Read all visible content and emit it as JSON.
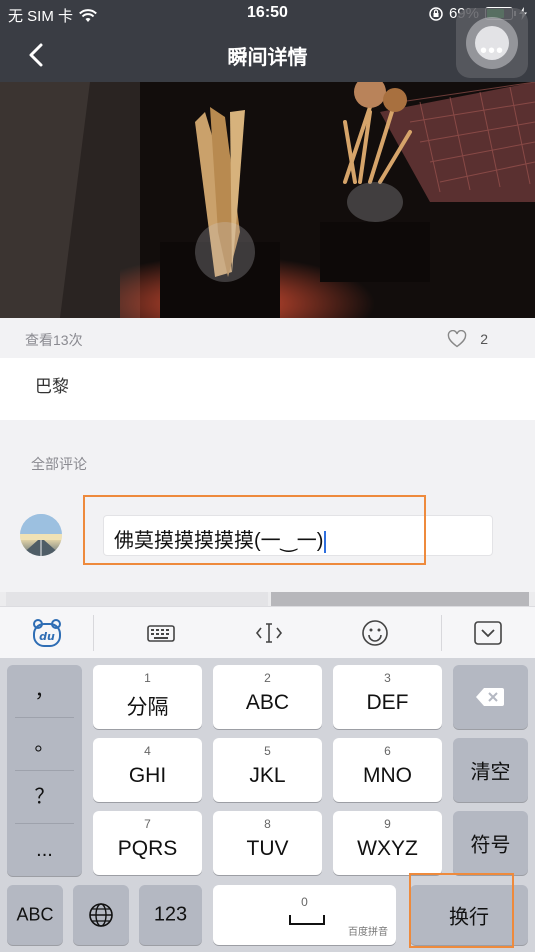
{
  "status_bar": {
    "carrier": "无 SIM 卡",
    "time": "16:50",
    "battery": "69%"
  },
  "nav": {
    "title": "瞬间详情",
    "more_dots": "•••"
  },
  "post": {
    "views": "查看13次",
    "likes": "2",
    "location": "巴黎"
  },
  "comments": {
    "section_title": "全部评论",
    "input_value": "佛莫摸摸摸摸摸(一‿一)"
  },
  "keyboard": {
    "punctuation": [
      "，",
      "。",
      "？",
      "..."
    ],
    "keys": [
      {
        "num": "1",
        "label": "分隔"
      },
      {
        "num": "2",
        "label": "ABC"
      },
      {
        "num": "3",
        "label": "DEF"
      },
      {
        "num": "4",
        "label": "GHI"
      },
      {
        "num": "5",
        "label": "JKL"
      },
      {
        "num": "6",
        "label": "MNO"
      },
      {
        "num": "7",
        "label": "PQRS"
      },
      {
        "num": "8",
        "label": "TUV"
      },
      {
        "num": "9",
        "label": "WXYZ"
      }
    ],
    "clear": "清空",
    "symbols": "符号",
    "abc": "ABC",
    "num123": "123",
    "space_num": "0",
    "space_tag": "百度拼音",
    "enter": "换行"
  }
}
